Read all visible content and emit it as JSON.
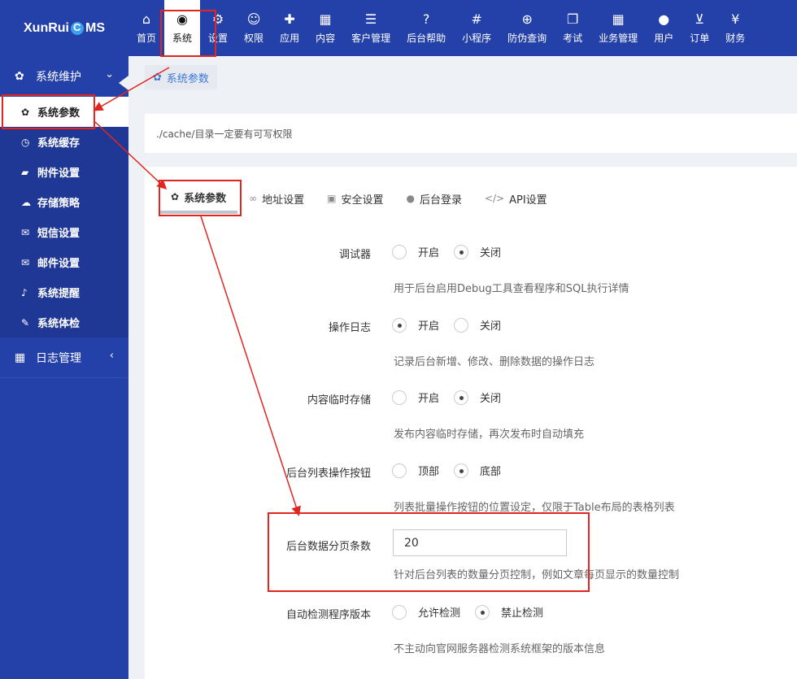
{
  "app": {
    "logo_pre": "XunRui",
    "logo_post": "MS"
  },
  "topnav": [
    {
      "icon": "home-icon",
      "glyph": "⌂",
      "label": "首页"
    },
    {
      "icon": "globe-icon",
      "glyph": "◉",
      "label": "系统",
      "active": true
    },
    {
      "icon": "cogs-icon",
      "glyph": "⚙",
      "label": "设置"
    },
    {
      "icon": "user-circle-icon",
      "glyph": "☺",
      "label": "权限"
    },
    {
      "icon": "puzzle-icon",
      "glyph": "✚",
      "label": "应用"
    },
    {
      "icon": "grid-icon",
      "glyph": "▦",
      "label": "内容"
    },
    {
      "icon": "list-icon",
      "glyph": "☰",
      "label": "客户管理"
    },
    {
      "icon": "question-icon",
      "glyph": "?",
      "label": "后台帮助"
    },
    {
      "icon": "slack-icon",
      "glyph": "#",
      "label": "小程序"
    },
    {
      "icon": "search-plus-icon",
      "glyph": "⊕",
      "label": "防伪查询"
    },
    {
      "icon": "clone-icon",
      "glyph": "❐",
      "label": "考试"
    },
    {
      "icon": "apps-icon",
      "glyph": "▦",
      "label": "业务管理"
    },
    {
      "icon": "user-icon",
      "glyph": "●",
      "label": "用户"
    },
    {
      "icon": "cart-icon",
      "glyph": "⊻",
      "label": "订单"
    },
    {
      "icon": "yen-icon",
      "glyph": "¥",
      "label": "财务"
    }
  ],
  "sidebar": {
    "group1": {
      "label": "系统维护",
      "chevron": "⌄"
    },
    "items": [
      {
        "icon": "cog-icon",
        "glyph": "✿",
        "label": "系统参数",
        "active": true
      },
      {
        "icon": "clock-icon",
        "glyph": "◷",
        "label": "系统缓存"
      },
      {
        "icon": "folder-icon",
        "glyph": "▰",
        "label": "附件设置"
      },
      {
        "icon": "cloud-icon",
        "glyph": "☁",
        "label": "存储策略"
      },
      {
        "icon": "envelope-icon",
        "glyph": "✉",
        "label": "短信设置"
      },
      {
        "icon": "envelope-open-icon",
        "glyph": "✉",
        "label": "邮件设置"
      },
      {
        "icon": "bell-icon",
        "glyph": "♪",
        "label": "系统提醒"
      },
      {
        "icon": "wrench-icon",
        "glyph": "✎",
        "label": "系统体检"
      }
    ],
    "group2": {
      "label": "日志管理",
      "chevron": "‹"
    }
  },
  "breadcrumb": {
    "label": "系统参数"
  },
  "notice": "./cache/目录一定要有可写权限",
  "tabs": [
    {
      "icon": "cog-icon",
      "glyph": "✿",
      "label": "系统参数",
      "active": true
    },
    {
      "icon": "link-icon",
      "glyph": "∞",
      "label": "地址设置"
    },
    {
      "icon": "lock-icon",
      "glyph": "▣",
      "label": "安全设置"
    },
    {
      "icon": "user-icon",
      "glyph": "●",
      "label": "后台登录"
    },
    {
      "icon": "code-icon",
      "glyph": "</>",
      "label": "API设置"
    }
  ],
  "form": {
    "debug": {
      "label": "调试器",
      "opt1": "开启",
      "opt2": "关闭",
      "selected": "关闭",
      "help": "用于后台启用Debug工具查看程序和SQL执行详情"
    },
    "oplog": {
      "label": "操作日志",
      "opt1": "开启",
      "opt2": "关闭",
      "selected": "开启",
      "help": "记录后台新增、修改、删除数据的操作日志"
    },
    "draft": {
      "label": "内容临时存储",
      "opt1": "开启",
      "opt2": "关闭",
      "selected": "关闭",
      "help": "发布内容临时存储，再次发布时自动填充"
    },
    "btnpos": {
      "label": "后台列表操作按钮",
      "opt1": "顶部",
      "opt2": "底部",
      "selected": "底部",
      "help": "列表批量操作按钮的位置设定，仅限于Table布局的表格列表"
    },
    "pagesize": {
      "label": "后台数据分页条数",
      "value": "20",
      "help": "针对后台列表的数量分页控制，例如文章每页显示的数量控制"
    },
    "version": {
      "label": "自动检测程序版本",
      "opt1": "允许检测",
      "opt2": "禁止检测",
      "selected": "禁止检测",
      "help": "不主动向官网服务器检测系统框架的版本信息"
    }
  },
  "colors": {
    "brand": "#2441a9",
    "annotation": "#e0261f",
    "link": "#3a78d8"
  }
}
